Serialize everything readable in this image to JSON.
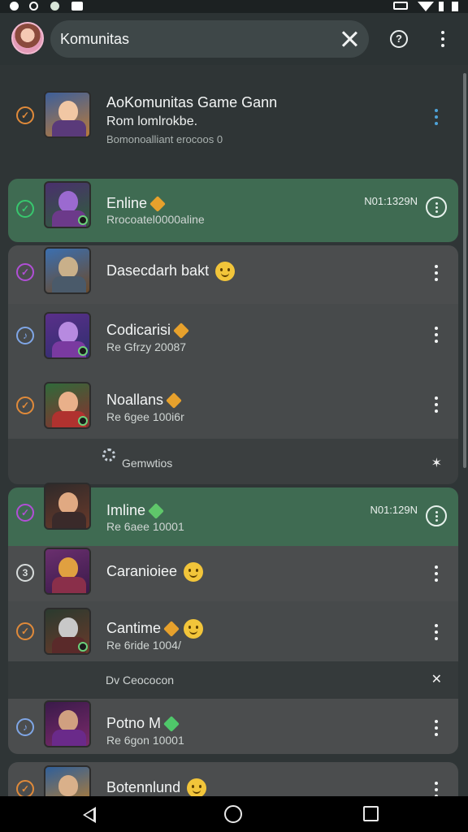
{
  "search": {
    "query": "Komunitas"
  },
  "sections": {
    "first": "Gemwtios",
    "second": "Dv Ceococon"
  },
  "rows": [
    {
      "title": "AoKomunitas Game Gann",
      "sub1": "Rom lomlrokbe.",
      "sub2": "Bomonoalliant erocoos 0",
      "check": "✓",
      "check_color": "#e08a3a"
    },
    {
      "title": "Enline",
      "sub": "Rrocoatel0000aline",
      "time": "N01:1329N",
      "check": "✓",
      "check_color": "#38c76e"
    },
    {
      "title": "Dasecdarh bakt",
      "check": "✓",
      "check_color": "#b14fd6"
    },
    {
      "title": "Codicarisi",
      "sub": "Re Gfrzy 20087",
      "check": "♪",
      "check_color": "#7fa6e6"
    },
    {
      "title": "Noallans",
      "sub": "Re 6gee 100i6r",
      "check": "✓",
      "check_color": "#e08a3a"
    },
    {
      "title": "Imline",
      "sub": "Re 6aee 10001",
      "time": "N01:129N",
      "check": "✓",
      "check_color": "#b14fd6"
    },
    {
      "title": "Caranioiee",
      "check": "3",
      "check_color": "#d7dcdb"
    },
    {
      "title": "Cantime",
      "sub": "Re 6ride 1004/",
      "check": "✓",
      "check_color": "#e08a3a"
    },
    {
      "title": "Potno M",
      "sub": "Re 6gon 10001",
      "check": "♪",
      "check_color": "#7fa6e6"
    },
    {
      "title": "Botennlund",
      "check": "✓",
      "check_color": "#e08a3a"
    }
  ]
}
